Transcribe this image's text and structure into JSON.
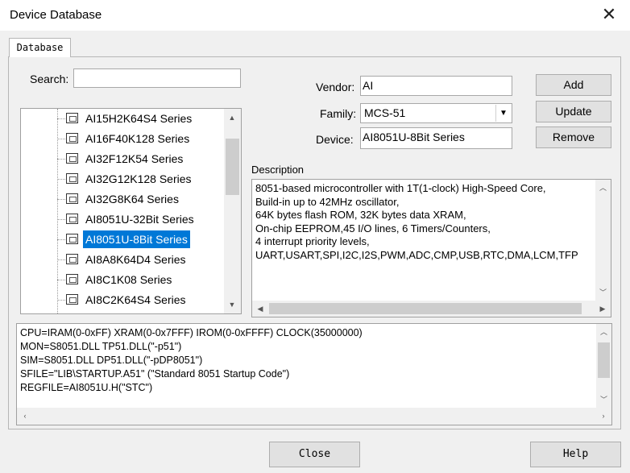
{
  "window": {
    "title": "Device Database",
    "close_glyph": "✕"
  },
  "tab": {
    "label": "Database"
  },
  "search": {
    "label": "Search:",
    "value": ""
  },
  "vendor": {
    "label": "Vendor:",
    "value": "AI"
  },
  "family": {
    "label": "Family:",
    "value": "MCS-51"
  },
  "device": {
    "label": "Device:",
    "value": "AI8051U-8Bit Series"
  },
  "buttons": {
    "add": "Add",
    "update": "Update",
    "remove": "Remove",
    "close": "Close",
    "help": "Help"
  },
  "device_list": {
    "items": [
      "AI15H2K64S4 Series",
      "AI16F40K128 Series",
      "AI32F12K54 Series",
      "AI32G12K128 Series",
      "AI32G8K64 Series",
      "AI8051U-32Bit Series",
      "AI8051U-8Bit Series",
      "AI8A8K64D4 Series",
      "AI8C1K08 Series",
      "AI8C2K64S4 Series"
    ],
    "selected_index": 6,
    "icon": "chip-icon"
  },
  "description": {
    "label": "Description",
    "lines": [
      "8051-based microcontroller with 1T(1-clock) High-Speed Core,",
      "Build-in up to 42MHz oscillator,",
      "64K bytes flash ROM, 32K bytes data XRAM,",
      "On-chip EEPROM,45 I/O lines, 6 Timers/Counters,",
      "4 interrupt priority levels,",
      "UART,USART,SPI,I2C,I2S,PWM,ADC,CMP,USB,RTC,DMA,LCM,TFP"
    ]
  },
  "config": {
    "lines": [
      "CPU=IRAM(0-0xFF) XRAM(0-0x7FFF) IROM(0-0xFFFF) CLOCK(35000000)",
      "MON=S8051.DLL TP51.DLL(\"-p51\")",
      "SIM=S8051.DLL DP51.DLL(\"-pDP8051\")",
      "SFILE=\"LIB\\STARTUP.A51\" (\"Standard 8051 Startup Code\")",
      "REGFILE=AI8051U.H(\"STC\")"
    ]
  },
  "colors": {
    "selection": "#0078d7",
    "window_bg": "#f0f0f0"
  }
}
